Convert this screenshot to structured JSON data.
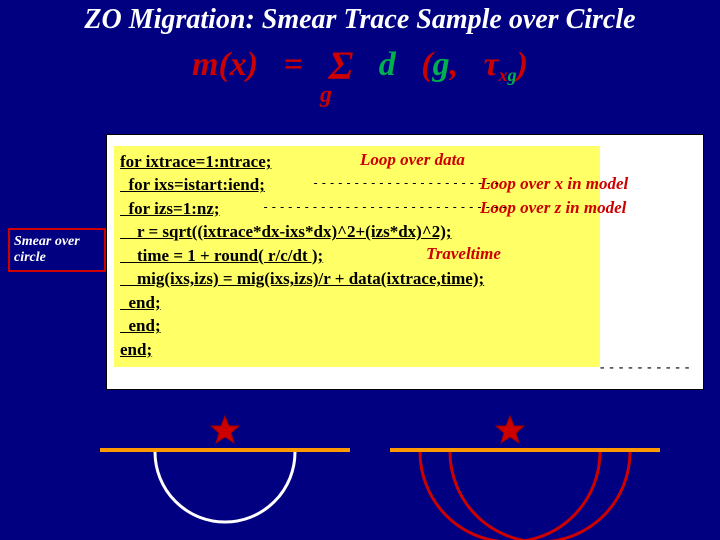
{
  "title": "ZO Migration: Smear Trace Sample over Circle",
  "formula": {
    "mx": "m(x)",
    "eq": "=",
    "sigma": "Σ",
    "d": "d",
    "lparen": "(",
    "g": "g",
    "comma": ",",
    "tau": "τ",
    "sub_x": "x",
    "sub_g": "g",
    "rparen": ")",
    "under_g": "g"
  },
  "smear_label": "Smear over circle",
  "code": {
    "l1": "for ixtrace=1:ntrace;",
    "l2": "  for ixs=istart:iend;",
    "l3": "  for izs=1:nz;",
    "l4": "    r = sqrt((ixtrace*dx-ixs*dx)^2+(izs*dx)^2);",
    "l5": "    time = 1 + round( r/c/dt );",
    "l6": "    mig(ixs,izs) = mig(ixs,izs)/r + data(ixtrace,time);",
    "l7": "  end;",
    "l8": "  end;",
    "l9": "end;"
  },
  "annot": {
    "loop_data": "Loop over data",
    "loop_x": "Loop over x in model",
    "loop_z": "Loop over z in model",
    "travel": "Traveltime"
  }
}
